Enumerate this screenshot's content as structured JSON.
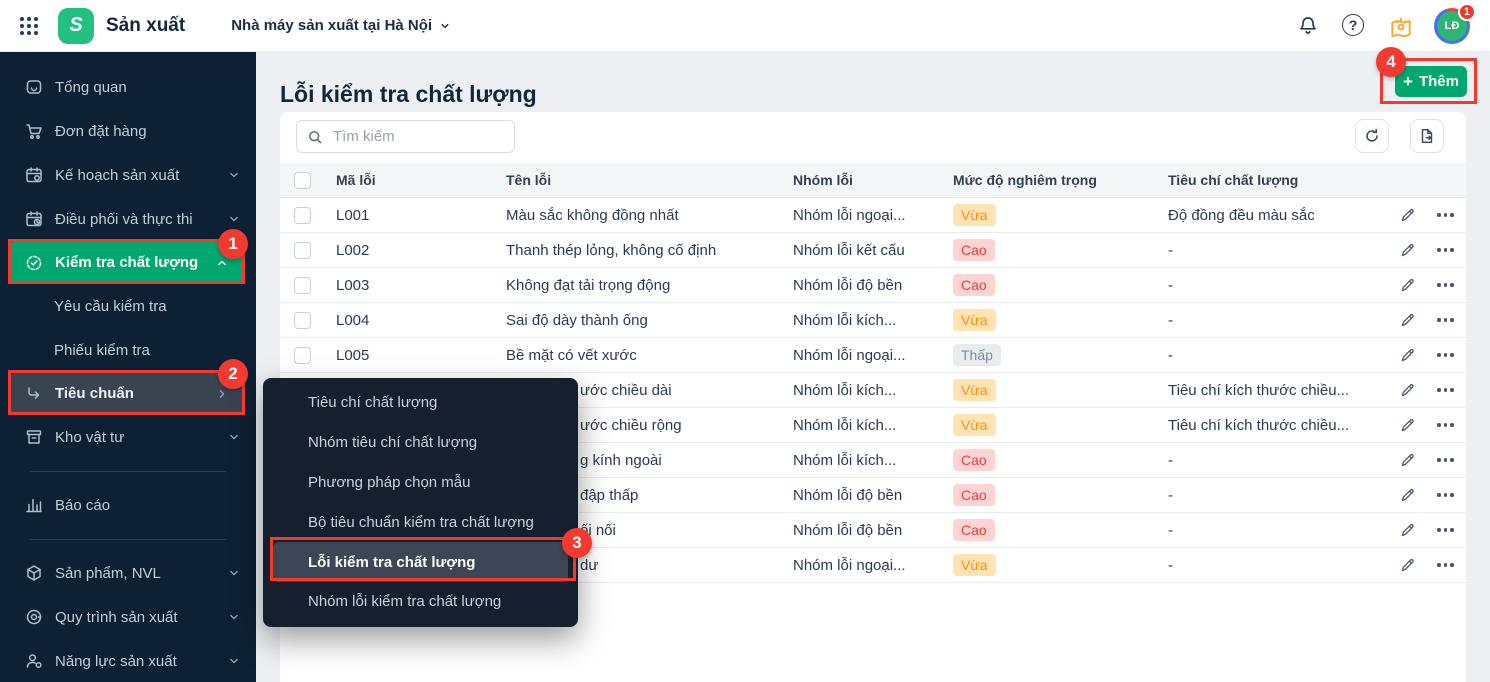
{
  "header": {
    "app_title": "Sản xuất",
    "factory_selector": "Nhà máy sản xuất tại Hà Nội",
    "help_glyph": "?",
    "avatar_initials": "LĐ",
    "avatar_badge": "1"
  },
  "sidebar": {
    "items": [
      {
        "label": "Tổng quan",
        "icon": "home-icon",
        "chevron": null,
        "style": "item"
      },
      {
        "label": "Đơn đặt hàng",
        "icon": "cart-icon",
        "chevron": null,
        "style": "item"
      },
      {
        "label": "Kế hoạch sản xuất",
        "icon": "calendar-gear-icon",
        "chevron": "down",
        "style": "item"
      },
      {
        "label": "Điều phối và thực thi",
        "icon": "calendar-clock-icon",
        "chevron": "down",
        "style": "item"
      },
      {
        "label": "Kiểm tra chất lượng",
        "icon": "check-circle-icon",
        "chevron": "up",
        "style": "active"
      },
      {
        "label": "Yêu cầu kiểm tra",
        "icon": null,
        "chevron": null,
        "style": "sub"
      },
      {
        "label": "Phiếu kiểm tra",
        "icon": null,
        "chevron": null,
        "style": "sub"
      },
      {
        "label": "Tiêu chuẩn",
        "icon": "corner-arrow-icon",
        "chevron": "right",
        "style": "selected"
      },
      {
        "label": "Kho vật tư",
        "icon": "archive-icon",
        "chevron": "down",
        "style": "item"
      },
      {
        "style": "divider"
      },
      {
        "label": "Báo cáo",
        "icon": "chart-icon",
        "chevron": null,
        "style": "item"
      },
      {
        "style": "divider"
      },
      {
        "label": "Sản phẩm, NVL",
        "icon": "cube-icon",
        "chevron": "down",
        "style": "item"
      },
      {
        "label": "Quy trình sản xuất",
        "icon": "process-icon",
        "chevron": "down",
        "style": "item"
      },
      {
        "label": "Năng lực sản xuất",
        "icon": "capacity-icon",
        "chevron": "down",
        "style": "item"
      }
    ]
  },
  "submenu": {
    "items": [
      {
        "label": "Tiêu chí chất lượng",
        "style": "item"
      },
      {
        "label": "Nhóm tiêu chí chất lượng",
        "style": "item"
      },
      {
        "label": "Phương pháp chọn mẫu",
        "style": "item"
      },
      {
        "label": "Bộ tiêu chuẩn kiểm tra chất lượng",
        "style": "item"
      },
      {
        "label": "Lỗi kiểm tra chất lượng",
        "style": "selected"
      },
      {
        "label": "Nhóm lỗi kiểm tra chất lượng",
        "style": "item"
      }
    ]
  },
  "main": {
    "page_title": "Lỗi kiểm tra chất lượng",
    "add_button_label": "Thêm",
    "search_placeholder": "Tìm kiếm",
    "table": {
      "columns": [
        "Mã lỗi",
        "Tên lỗi",
        "Nhóm lỗi",
        "Mức độ nghiêm trọng",
        "Tiêu chí chất lượng"
      ],
      "rows": [
        {
          "code": "L001",
          "name": "Màu sắc không đồng nhất",
          "group": "Nhóm lỗi ngoại...",
          "severity": "Vừa",
          "criteria": "Độ đồng đều màu sắc",
          "covered": false
        },
        {
          "code": "L002",
          "name": "Thanh thép lỏng, không cố định",
          "group": "Nhóm lỗi kết cấu",
          "severity": "Cao",
          "criteria": "-",
          "covered": false
        },
        {
          "code": "L003",
          "name": "Không đạt tải trọng động",
          "group": "Nhóm lỗi độ bền",
          "severity": "Cao",
          "criteria": "-",
          "covered": false
        },
        {
          "code": "L004",
          "name": "Sai độ dày thành ống",
          "group": "Nhóm lỗi kích...",
          "severity": "Vừa",
          "criteria": "-",
          "covered": false
        },
        {
          "code": "L005",
          "name": "Bề mặt có vết xước",
          "group": "Nhóm lỗi ngoại...",
          "severity": "Thấp",
          "criteria": "-",
          "covered": false
        },
        {
          "code": "",
          "name": "ước chiều dài",
          "group": "Nhóm lỗi kích...",
          "severity": "Vừa",
          "criteria": "Tiêu chí kích thước chiều...",
          "covered": true
        },
        {
          "code": "",
          "name": "ước chiều rộng",
          "group": "Nhóm lỗi kích...",
          "severity": "Vừa",
          "criteria": "Tiêu chí kích thước chiều...",
          "covered": true
        },
        {
          "code": "",
          "name": "g kính ngoài",
          "group": "Nhóm lỗi kích...",
          "severity": "Cao",
          "criteria": "-",
          "covered": true
        },
        {
          "code": "",
          "name": "đập thấp",
          "group": "Nhóm lỗi độ bền",
          "severity": "Cao",
          "criteria": "-",
          "covered": true
        },
        {
          "code": "",
          "name": "ối nối",
          "group": "Nhóm lỗi độ bền",
          "severity": "Cao",
          "criteria": "-",
          "covered": true
        },
        {
          "code": "",
          "name": "dư",
          "group": "Nhóm lỗi ngoại...",
          "severity": "Vừa",
          "criteria": "-",
          "covered": true
        }
      ]
    }
  },
  "annotations": {
    "step1": "1",
    "step2": "2",
    "step3": "3",
    "step4": "4"
  },
  "colors": {
    "brand_green": "#00a76f",
    "annotation_red": "#f23a31",
    "sidebar_bg": "#0e2033",
    "popup_bg": "#151f2d",
    "severity": {
      "Vừa": {
        "bg": "#ffe3b3",
        "fg": "#f0930f"
      },
      "Cao": {
        "bg": "#ffd3d2",
        "fg": "#e2403c"
      },
      "Thấp": {
        "bg": "#e9ecef",
        "fg": "#818c99"
      }
    }
  }
}
